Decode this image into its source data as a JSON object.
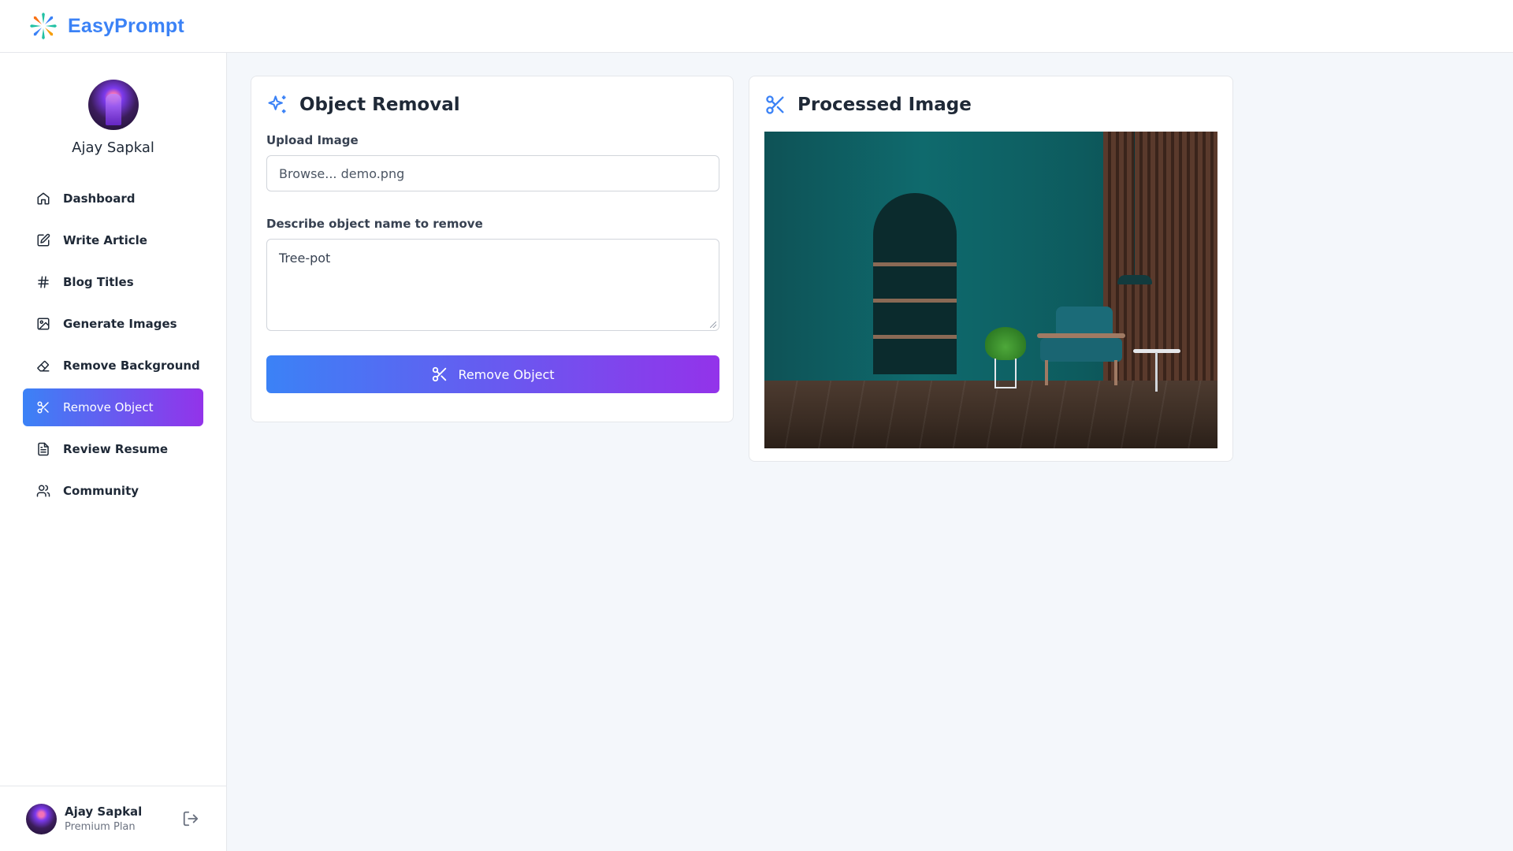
{
  "app": {
    "brand": "EasyPrompt"
  },
  "profile": {
    "name": "Ajay Sapkal"
  },
  "nav": {
    "items": [
      {
        "label": "Dashboard",
        "icon": "home-icon"
      },
      {
        "label": "Write Article",
        "icon": "edit-icon"
      },
      {
        "label": "Blog Titles",
        "icon": "hash-icon"
      },
      {
        "label": "Generate Images",
        "icon": "image-icon"
      },
      {
        "label": "Remove Background",
        "icon": "eraser-icon"
      },
      {
        "label": "Remove Object",
        "icon": "scissors-icon",
        "active": true
      },
      {
        "label": "Review Resume",
        "icon": "file-text-icon"
      },
      {
        "label": "Community",
        "icon": "users-icon"
      }
    ]
  },
  "footer": {
    "name": "Ajay Sapkal",
    "plan": "Premium Plan"
  },
  "object_removal": {
    "title": "Object Removal",
    "upload_label": "Upload Image",
    "upload_value": "Browse... demo.png",
    "describe_label": "Describe object name to remove",
    "describe_value": "Tree-pot",
    "button_label": "Remove Object"
  },
  "processed": {
    "title": "Processed Image"
  },
  "colors": {
    "accent_start": "#3b82f6",
    "accent_end": "#9333ea",
    "brand": "#3b82f6"
  }
}
